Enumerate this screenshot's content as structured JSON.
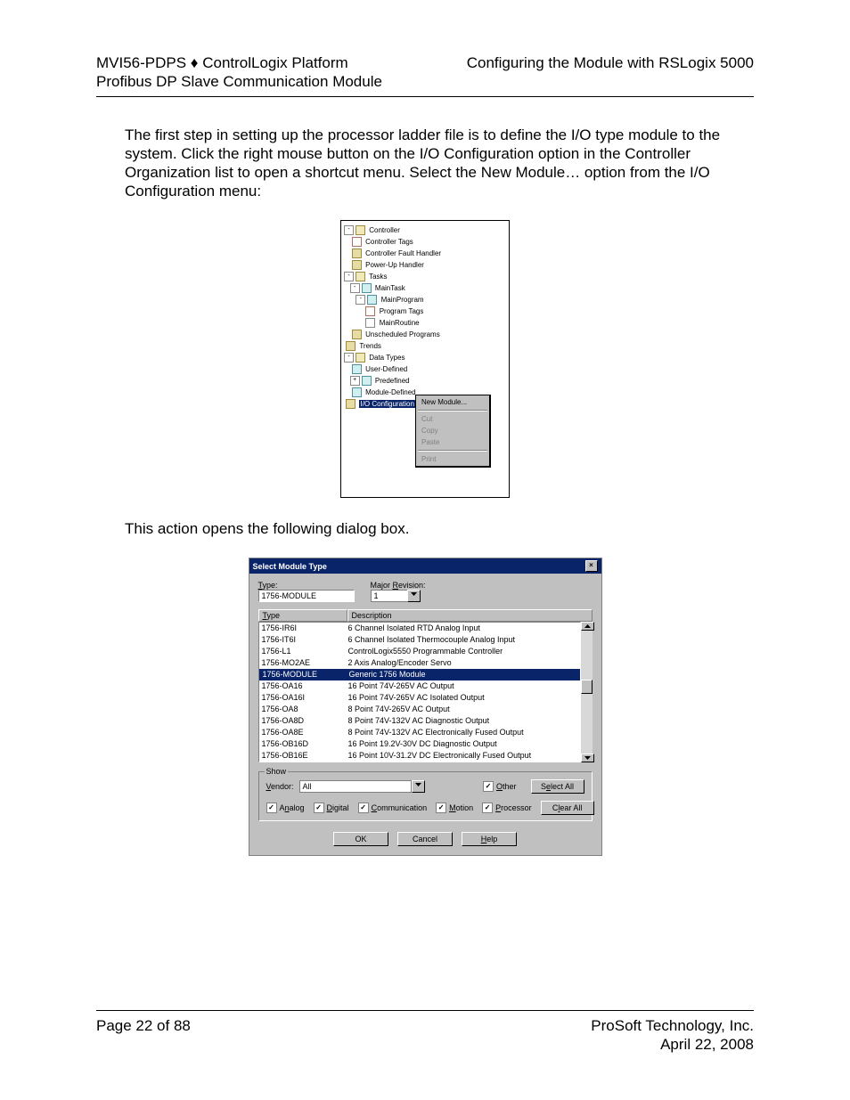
{
  "header": {
    "left_line1": "MVI56-PDPS ♦ ControlLogix Platform",
    "left_line2": "Profibus DP Slave Communication Module",
    "right": "Configuring the Module with RSLogix 5000"
  },
  "para1": "The first step in setting up the processor ladder file is to define the I/O type module to the system. Click the right mouse button on the I/O Configuration option in the Controller Organization list to open a shortcut menu. Select the New Module… option from the I/O Configuration menu:",
  "para2": "This action opens the following dialog box.",
  "tree": {
    "items": [
      "Controller",
      "Controller Tags",
      "Controller Fault Handler",
      "Power-Up Handler",
      "Tasks",
      "MainTask",
      "MainProgram",
      "Program Tags",
      "MainRoutine",
      "Unscheduled Programs",
      "Trends",
      "Data Types",
      "User-Defined",
      "Predefined",
      "Module-Defined",
      "I/O Configuration"
    ],
    "context_menu": {
      "new_module": "New Module...",
      "cut": "Cut",
      "copy": "Copy",
      "paste": "Paste",
      "print": "Print"
    }
  },
  "dialog": {
    "title": "Select Module Type",
    "type_label": "Type:",
    "type_value": "1756-MODULE",
    "major_rev_label": "Major Revision:",
    "major_rev_value": "1",
    "col_type": "Type",
    "col_desc": "Description",
    "rows": [
      {
        "t": "1756-IR6I",
        "d": "6 Channel Isolated RTD Analog Input"
      },
      {
        "t": "1756-IT6I",
        "d": "6 Channel Isolated Thermocouple Analog Input"
      },
      {
        "t": "1756-L1",
        "d": "ControlLogix5550 Programmable Controller"
      },
      {
        "t": "1756-MO2AE",
        "d": "2 Axis Analog/Encoder Servo"
      },
      {
        "t": "1756-MODULE",
        "d": "Generic 1756 Module",
        "selected": true
      },
      {
        "t": "1756-OA16",
        "d": "16 Point 74V-265V AC Output"
      },
      {
        "t": "1756-OA16I",
        "d": "16 Point 74V-265V AC Isolated Output"
      },
      {
        "t": "1756-OA8",
        "d": "8 Point 74V-265V AC Output"
      },
      {
        "t": "1756-OA8D",
        "d": "8 Point 74V-132V AC Diagnostic Output"
      },
      {
        "t": "1756-OA8E",
        "d": "8 Point 74V-132V AC Electronically Fused Output"
      },
      {
        "t": "1756-OB16D",
        "d": "16 Point 19.2V-30V DC Diagnostic Output"
      },
      {
        "t": "1756-OB16E",
        "d": "16 Point 10V-31.2V DC Electronically Fused Output"
      }
    ],
    "show": {
      "title": "Show",
      "vendor_label": "Vendor:",
      "vendor_value": "All",
      "other_label": "Other",
      "select_all": "Select All",
      "clear_all": "Clear All",
      "analog": "Analog",
      "digital": "Digital",
      "communication": "Communication",
      "motion": "Motion",
      "processor": "Processor"
    },
    "buttons": {
      "ok": "OK",
      "cancel": "Cancel",
      "help": "Help"
    }
  },
  "footer": {
    "page": "Page 22 of 88",
    "company": "ProSoft Technology, Inc.",
    "date": "April 22, 2008"
  }
}
